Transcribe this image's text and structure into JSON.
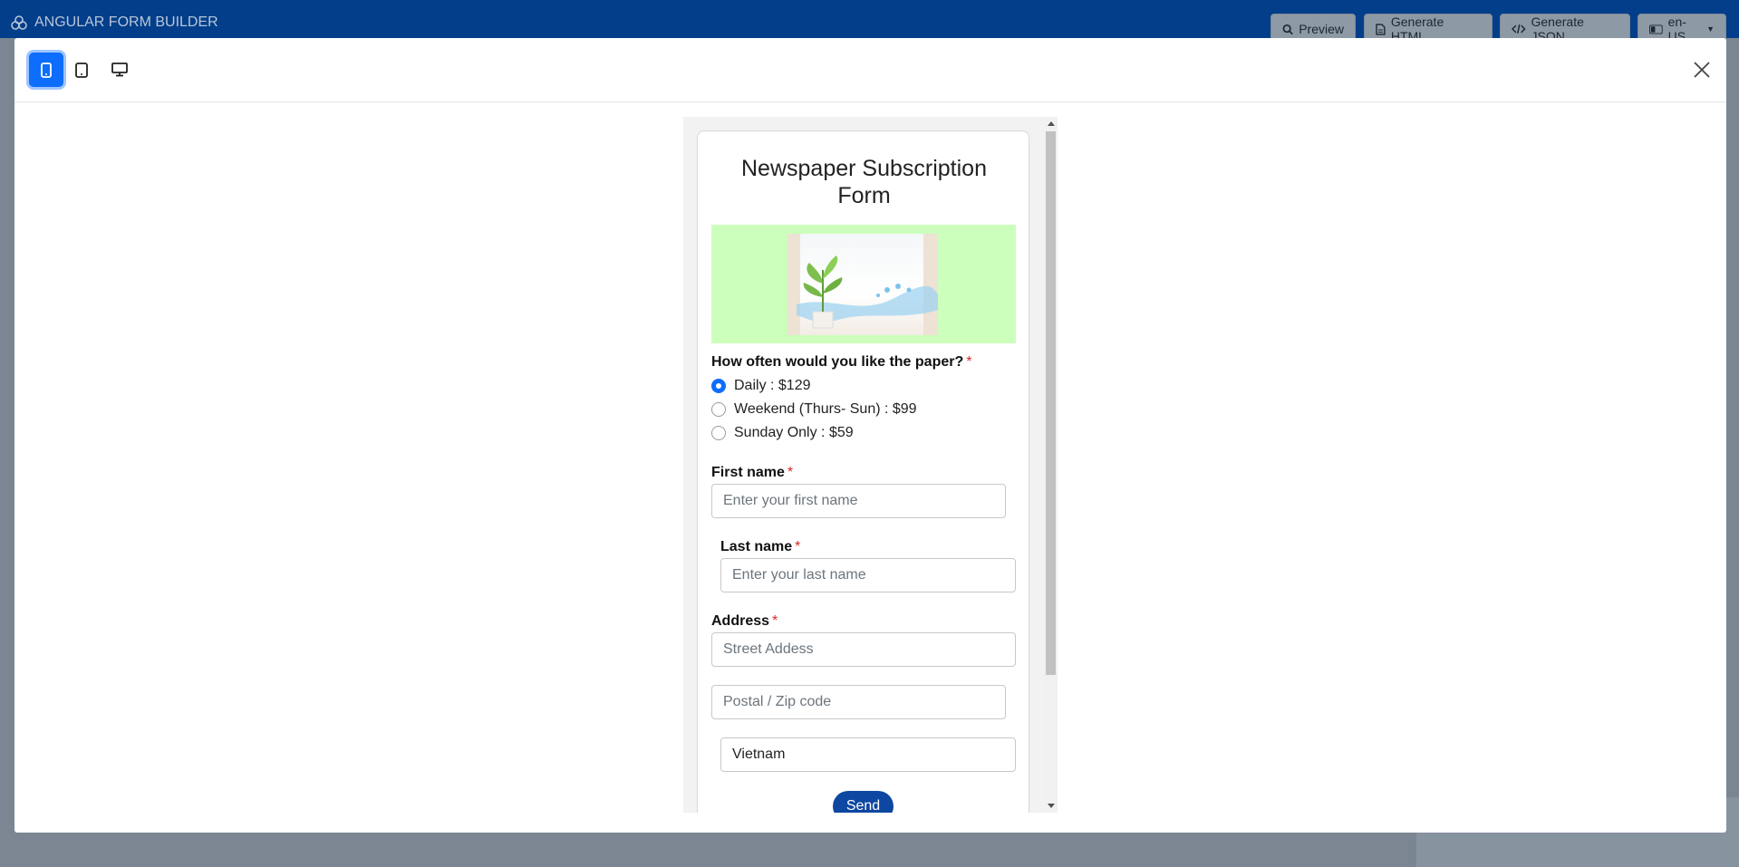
{
  "app": {
    "title": "ANGULAR FORM BUILDER",
    "header_buttons": [
      {
        "label": "Preview",
        "icon": "search-icon"
      },
      {
        "label": "Generate HTML",
        "icon": "file-icon"
      },
      {
        "label": "Generate JSON",
        "icon": "code-icon"
      },
      {
        "label": "en-US",
        "icon": "language-icon"
      }
    ]
  },
  "modal": {
    "devices": [
      {
        "name": "mobile",
        "icon": "mobile-icon",
        "active": true
      },
      {
        "name": "tablet",
        "icon": "tablet-icon",
        "active": false
      },
      {
        "name": "desktop",
        "icon": "desktop-icon",
        "active": false
      }
    ],
    "accent_color": "#0d6efd"
  },
  "form": {
    "title": "Newspaper Subscription Form",
    "image_bg_color": "#ccffbb",
    "question": {
      "label": "How often would you like the paper?",
      "required_mark": "*",
      "options": [
        {
          "label": "Daily : $129",
          "checked": true
        },
        {
          "label": "Weekend (Thurs- Sun) : $99",
          "checked": false
        },
        {
          "label": "Sunday Only : $59",
          "checked": false
        }
      ]
    },
    "first_name": {
      "label": "First name",
      "required_mark": "*",
      "placeholder": "Enter your first name"
    },
    "last_name": {
      "label": "Last name",
      "required_mark": "*",
      "placeholder": "Enter your last name"
    },
    "address": {
      "label": "Address",
      "required_mark": "*",
      "street_placeholder": "Street Addess",
      "zip_placeholder": "Postal / Zip code",
      "country_value": "Vietnam"
    },
    "submit_label": "Send",
    "submit_color": "#0d47a1"
  }
}
